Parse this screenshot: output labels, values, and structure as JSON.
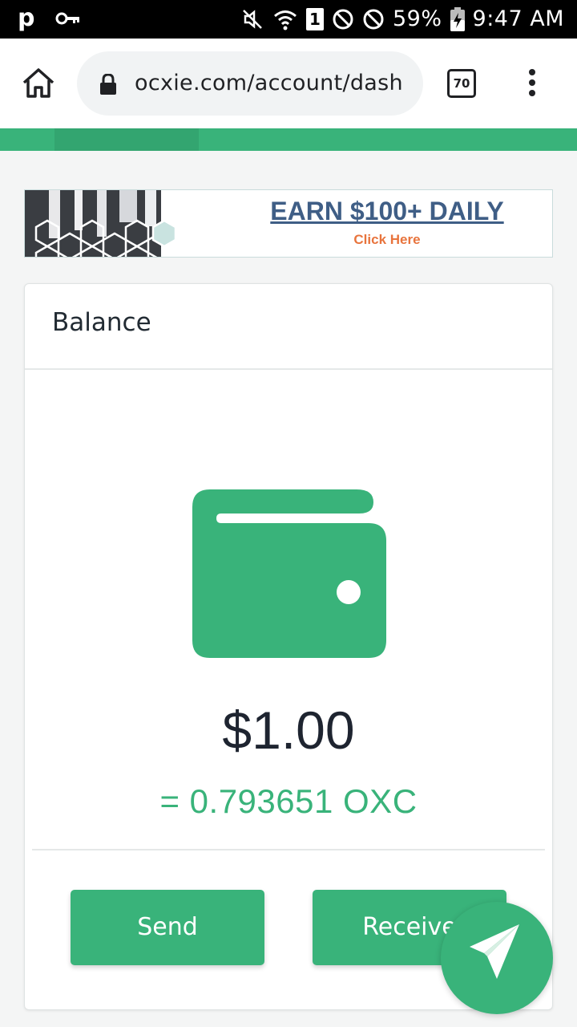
{
  "status_bar": {
    "app_letter": "p",
    "sim_slot": "1",
    "battery": "59%",
    "time": "9:47 AM",
    "icons": [
      "pinterest-icon",
      "key-icon",
      "mute-icon",
      "wifi-icon",
      "sim-icon",
      "block-icon",
      "block-icon",
      "battery-charging-icon"
    ]
  },
  "browser": {
    "url": "ocxie.com/account/dash",
    "tab_count": "70",
    "icons": [
      "home-icon",
      "lock-icon",
      "tabs-icon",
      "overflow-menu-icon"
    ]
  },
  "banner": {
    "headline": "EARN $100+ DAILY",
    "cta": "Click Here"
  },
  "balance_card": {
    "title": "Balance",
    "amount": "$1.00",
    "crypto_equivalent": "= 0.793651 OXC",
    "send_label": "Send",
    "receive_label": "Receive",
    "icon": "wallet-icon"
  },
  "fab": {
    "icon": "telegram-icon"
  },
  "colors": {
    "accent": "#39b37a",
    "text_dark": "#1e2430",
    "banner_headline": "#3f5e86",
    "banner_cta": "#e8743d"
  }
}
